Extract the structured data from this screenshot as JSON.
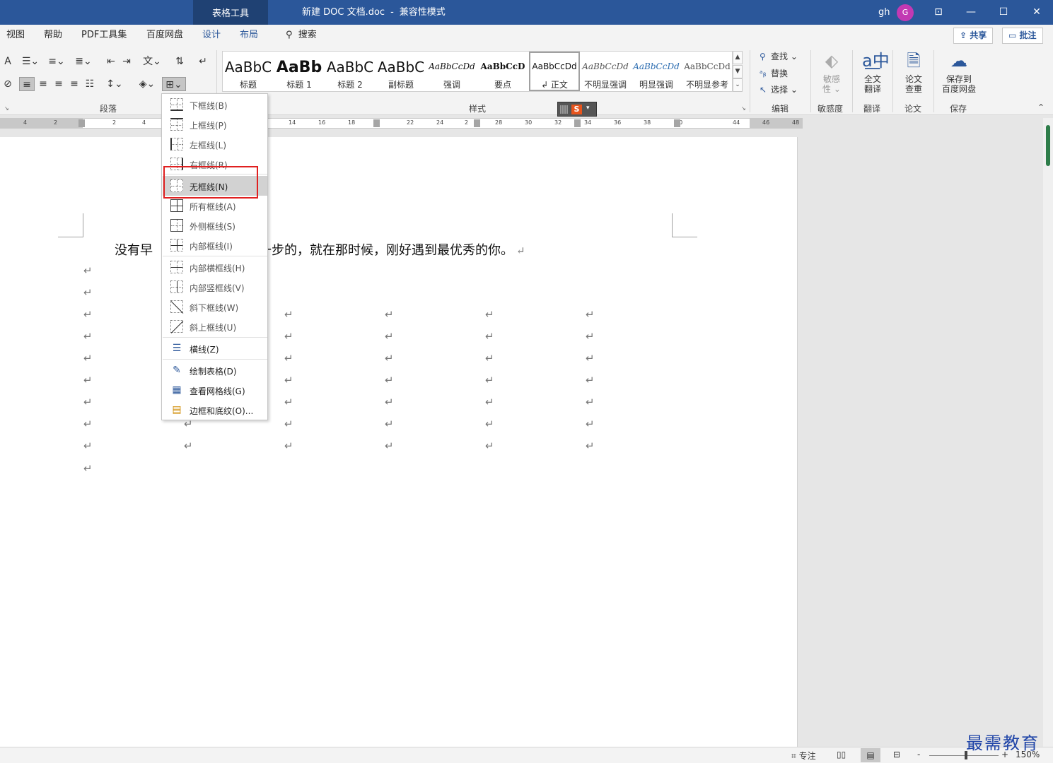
{
  "titlebar": {
    "context_tab": "表格工具",
    "doc_name": "新建 DOC 文档.doc",
    "separator": "-",
    "mode": "兼容性模式",
    "user": "gh",
    "avatar_initial": "G"
  },
  "ribbon_tabs": [
    {
      "label": "视图",
      "ctx": false
    },
    {
      "label": "帮助",
      "ctx": false
    },
    {
      "label": "PDF工具集",
      "ctx": false
    },
    {
      "label": "百度网盘",
      "ctx": false
    },
    {
      "label": "设计",
      "ctx": true
    },
    {
      "label": "布局",
      "ctx": true
    }
  ],
  "search": {
    "label": "搜索"
  },
  "share": {
    "label": "共享",
    "comment_label": "批注"
  },
  "groups": {
    "paragraph": "段落",
    "styles": "样式",
    "editing": "编辑",
    "sensitivity": "敏感度",
    "translate": "翻译",
    "paper": "论文",
    "save": "保存"
  },
  "styles": [
    {
      "sample": "AaBbC",
      "name": "标题"
    },
    {
      "sample": "AaBb",
      "name": "标题 1"
    },
    {
      "sample": "AaBbC",
      "name": "标题 2"
    },
    {
      "sample": "AaBbC",
      "name": "副标题"
    },
    {
      "sample": "AaBbCcDd",
      "name": "强调"
    },
    {
      "sample": "AaBbCcD",
      "name": "要点"
    },
    {
      "sample": "AaBbCcDd",
      "name": "↲ 正文"
    },
    {
      "sample": "AaBbCcDd",
      "name": "不明显强调"
    },
    {
      "sample": "AaBbCcDd",
      "name": "明显强调"
    },
    {
      "sample": "AaBbCcDd",
      "name": "不明显参考"
    }
  ],
  "editing": {
    "find": "查找",
    "replace": "替换",
    "select": "选择"
  },
  "big_buttons": {
    "sensitivity": [
      "敏感",
      "性"
    ],
    "translate": [
      "全文",
      "翻译"
    ],
    "paper": [
      "论文",
      "查重"
    ],
    "save": [
      "保存到",
      "百度网盘"
    ]
  },
  "ruler_ticks": [
    "4",
    "2",
    "2",
    "4",
    "14",
    "16",
    "18",
    "22",
    "24",
    "2",
    "28",
    "30",
    "32",
    "34",
    "36",
    "38",
    "40",
    "44",
    "46",
    "48"
  ],
  "sogou": {
    "logo": "S"
  },
  "document": {
    "line_left": "没有早",
    "line_right": "一步的，就在那时候，刚好遇到最优秀的你。",
    "para_mark": "↵"
  },
  "border_menu": {
    "items": [
      {
        "label": "下框线(B)"
      },
      {
        "label": "上框线(P)"
      },
      {
        "label": "左框线(L)"
      },
      {
        "label": "右框线(R)"
      },
      {
        "label": "无框线(N)"
      },
      {
        "label": "所有框线(A)"
      },
      {
        "label": "外侧框线(S)"
      },
      {
        "label": "内部框线(I)"
      },
      {
        "label": "内部横框线(H)"
      },
      {
        "label": "内部竖框线(V)"
      },
      {
        "label": "斜下框线(W)"
      },
      {
        "label": "斜上框线(U)"
      },
      {
        "label": "横线(Z)"
      },
      {
        "label": "绘制表格(D)"
      },
      {
        "label": "查看网格线(G)"
      },
      {
        "label": "边框和底纹(O)..."
      }
    ]
  },
  "statusbar": {
    "focus": "专注",
    "zoom_minus": "-",
    "zoom_plus": "+",
    "zoom": "150%"
  },
  "watermark": "最需教育",
  "colors": {
    "titlebar": "#2b579a",
    "highlight_box": "#e02020",
    "avatar": "#c239b3"
  }
}
